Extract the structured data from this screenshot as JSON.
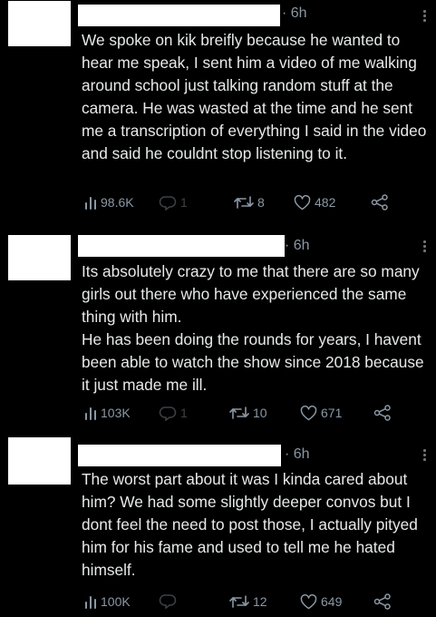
{
  "tweets": [
    {
      "time": "· 6h",
      "text": "We spoke on kik breifly because he wanted to hear me speak, I sent him a video of me walking around school just talking random stuff at the camera. He was wasted at the time and he sent me a transcription of everything I said in the video and said he couldnt stop listening to it.",
      "views": "98.6K",
      "replies": "1",
      "retweets": "8",
      "likes": "482"
    },
    {
      "time": "· 6h",
      "text": "Its absolutely crazy to me that there are so many girls out there who have experienced the same thing with him.\nHe has been doing the rounds for years, I havent been able to watch the show since 2018 because it just made me ill.",
      "views": "103K",
      "replies": "1",
      "retweets": "10",
      "likes": "671"
    },
    {
      "time": "· 6h",
      "text": "The worst part about it was I kinda cared about him? We had some slightly deeper convos but I dont feel the need to post those, I actually pityed him for his fame and used to tell me he hated himself.",
      "views": "100K",
      "replies": "",
      "retweets": "12",
      "likes": "649"
    }
  ],
  "icons": {
    "views": "bar-chart-icon",
    "reply": "speech-bubble-icon",
    "retweet": "retweet-arrows-icon",
    "like": "heart-outline-icon",
    "share": "share-nodes-icon",
    "more": "vertical-ellipsis-icon"
  },
  "colors": {
    "background": "#000000",
    "text": "#e7e9ea",
    "muted": "#8b98a5"
  }
}
